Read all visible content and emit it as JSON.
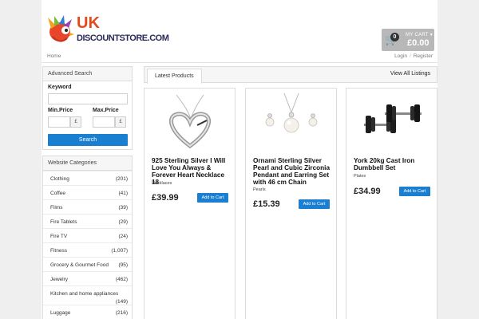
{
  "header": {
    "logo_uk": "UK",
    "logo_store": "DISCOUNTSTORE.COM",
    "cart": {
      "count": "0",
      "label": "MY CART",
      "amount": "£0.00",
      "icon": "shopping-cart-icon"
    }
  },
  "nav": {
    "home": "Home",
    "login": "Login",
    "register": "Register"
  },
  "advanced_search": {
    "title": "Advanced Search",
    "keyword_label": "Keyword",
    "min_label": "Min.Price",
    "max_label": "Max.Price",
    "currency": "£",
    "search_button": "Search"
  },
  "categories": {
    "title": "Website Categories",
    "items": [
      {
        "name": "Clothing",
        "count": "(201)"
      },
      {
        "name": "Coffee",
        "count": "(41)"
      },
      {
        "name": "Films",
        "count": "(39)"
      },
      {
        "name": "Fire Tablets",
        "count": "(29)"
      },
      {
        "name": "Fire TV",
        "count": "(24)"
      },
      {
        "name": "Fitness",
        "count": "(1,007)"
      },
      {
        "name": "Grocery & Gourmet Food",
        "count": "(95)"
      },
      {
        "name": "Jewelry",
        "count": "(462)"
      },
      {
        "name": "Kitchen and home appliances",
        "count": "(149)"
      },
      {
        "name": "Luggage",
        "count": "(216)"
      }
    ]
  },
  "main": {
    "tab": "Latest Products",
    "view_all": "View All Listings",
    "add_to_cart": "Add to Cart",
    "products": [
      {
        "title": "925 Sterling Silver I Will Love You Always & Forever Heart Necklace 18",
        "category": "Necklaces",
        "price": "£39.99",
        "image": "heart-necklace"
      },
      {
        "title": "Ornami Sterling Silver Pearl and Cubic Zirconia Pendant and Earring Set with 46 cm Chain",
        "category": "Pearls",
        "price": "£15.39",
        "image": "pearl-pendant-set"
      },
      {
        "title": "York 20kg Cast Iron Dumbbell Set",
        "category": "Plates",
        "price": "£34.99",
        "image": "dumbbell-set"
      }
    ]
  }
}
